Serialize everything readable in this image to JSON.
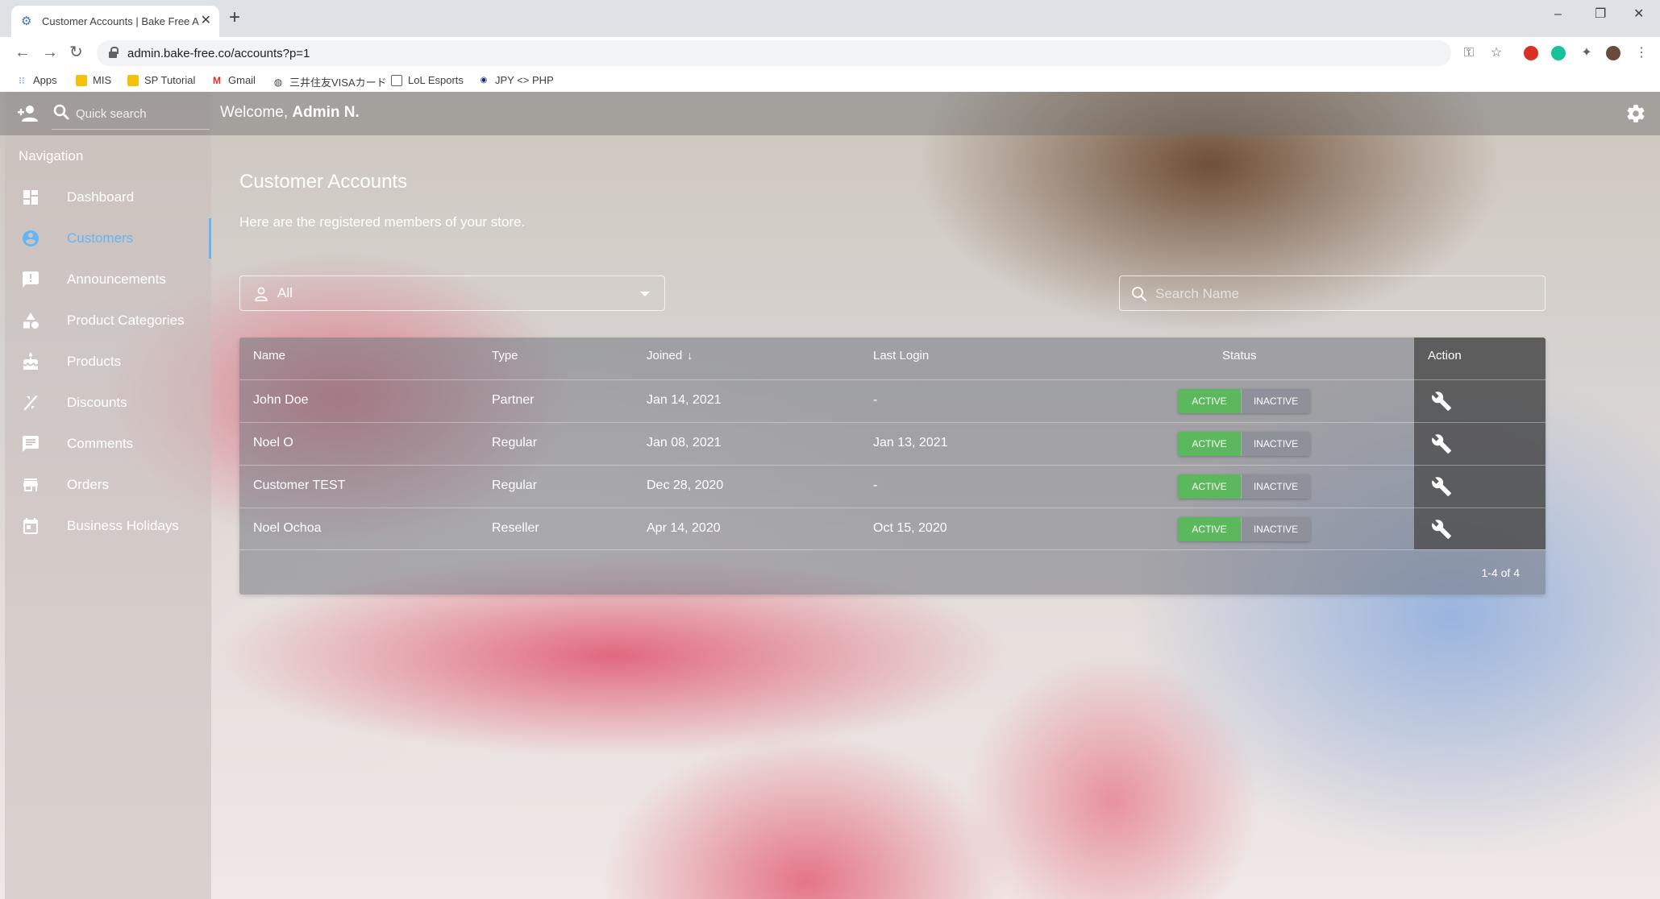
{
  "browser": {
    "tab_title": "Customer Accounts | Bake Free A",
    "url": "admin.bake-free.co/accounts?p=1",
    "bookmarks": [
      {
        "label": "Apps",
        "icon": "apps-grid-icon"
      },
      {
        "label": "MIS",
        "icon": "folder-icon"
      },
      {
        "label": "SP Tutorial",
        "icon": "folder-icon"
      },
      {
        "label": "Gmail",
        "icon": "gmail-icon"
      },
      {
        "label": "三井住友VISAカード",
        "icon": "globe-icon"
      },
      {
        "label": "LoL Esports",
        "icon": "lol-icon"
      },
      {
        "label": "JPY <> PHP",
        "icon": "currency-icon"
      }
    ]
  },
  "header": {
    "quick_search_placeholder": "Quick search",
    "welcome_prefix": "Welcome, ",
    "welcome_user": "Admin N."
  },
  "sidebar": {
    "heading": "Navigation",
    "items": [
      {
        "label": "Dashboard",
        "icon": "dashboard-icon",
        "active": false
      },
      {
        "label": "Customers",
        "icon": "account-circle-icon",
        "active": true
      },
      {
        "label": "Announcements",
        "icon": "announcement-icon",
        "active": false
      },
      {
        "label": "Product Categories",
        "icon": "category-shapes-icon",
        "active": false
      },
      {
        "label": "Products",
        "icon": "cake-icon",
        "active": false
      },
      {
        "label": "Discounts",
        "icon": "discount-icon",
        "active": false
      },
      {
        "label": "Comments",
        "icon": "comment-icon",
        "active": false
      },
      {
        "label": "Orders",
        "icon": "store-icon",
        "active": false
      },
      {
        "label": "Business Holidays",
        "icon": "calendar-icon",
        "active": false
      }
    ]
  },
  "main": {
    "title": "Customer Accounts",
    "subtitle": "Here are the registered members of your store.",
    "filter_value": "All",
    "search_placeholder": "Search Name",
    "columns": {
      "name": "Name",
      "type": "Type",
      "joined": "Joined",
      "last_login": "Last Login",
      "status": "Status",
      "action": "Action"
    },
    "rows": [
      {
        "name": "John Doe",
        "type": "Partner",
        "joined": "Jan 14, 2021",
        "last_login": "-",
        "active_label": "ACTIVE",
        "inactive_label": "INACTIVE"
      },
      {
        "name": "Noel O",
        "type": "Regular",
        "joined": "Jan 08, 2021",
        "last_login": "Jan 13, 2021",
        "active_label": "ACTIVE",
        "inactive_label": "INACTIVE"
      },
      {
        "name": "Customer TEST",
        "type": "Regular",
        "joined": "Dec 28, 2020",
        "last_login": "-",
        "active_label": "ACTIVE",
        "inactive_label": "INACTIVE"
      },
      {
        "name": "Noel Ochoa",
        "type": "Reseller",
        "joined": "Apr 14, 2020",
        "last_login": "Oct 15, 2020",
        "active_label": "ACTIVE",
        "inactive_label": "INACTIVE"
      }
    ],
    "pagination": "1-4 of 4"
  },
  "colors": {
    "accent": "#64b5f6",
    "active_green": "#5cb85c"
  }
}
